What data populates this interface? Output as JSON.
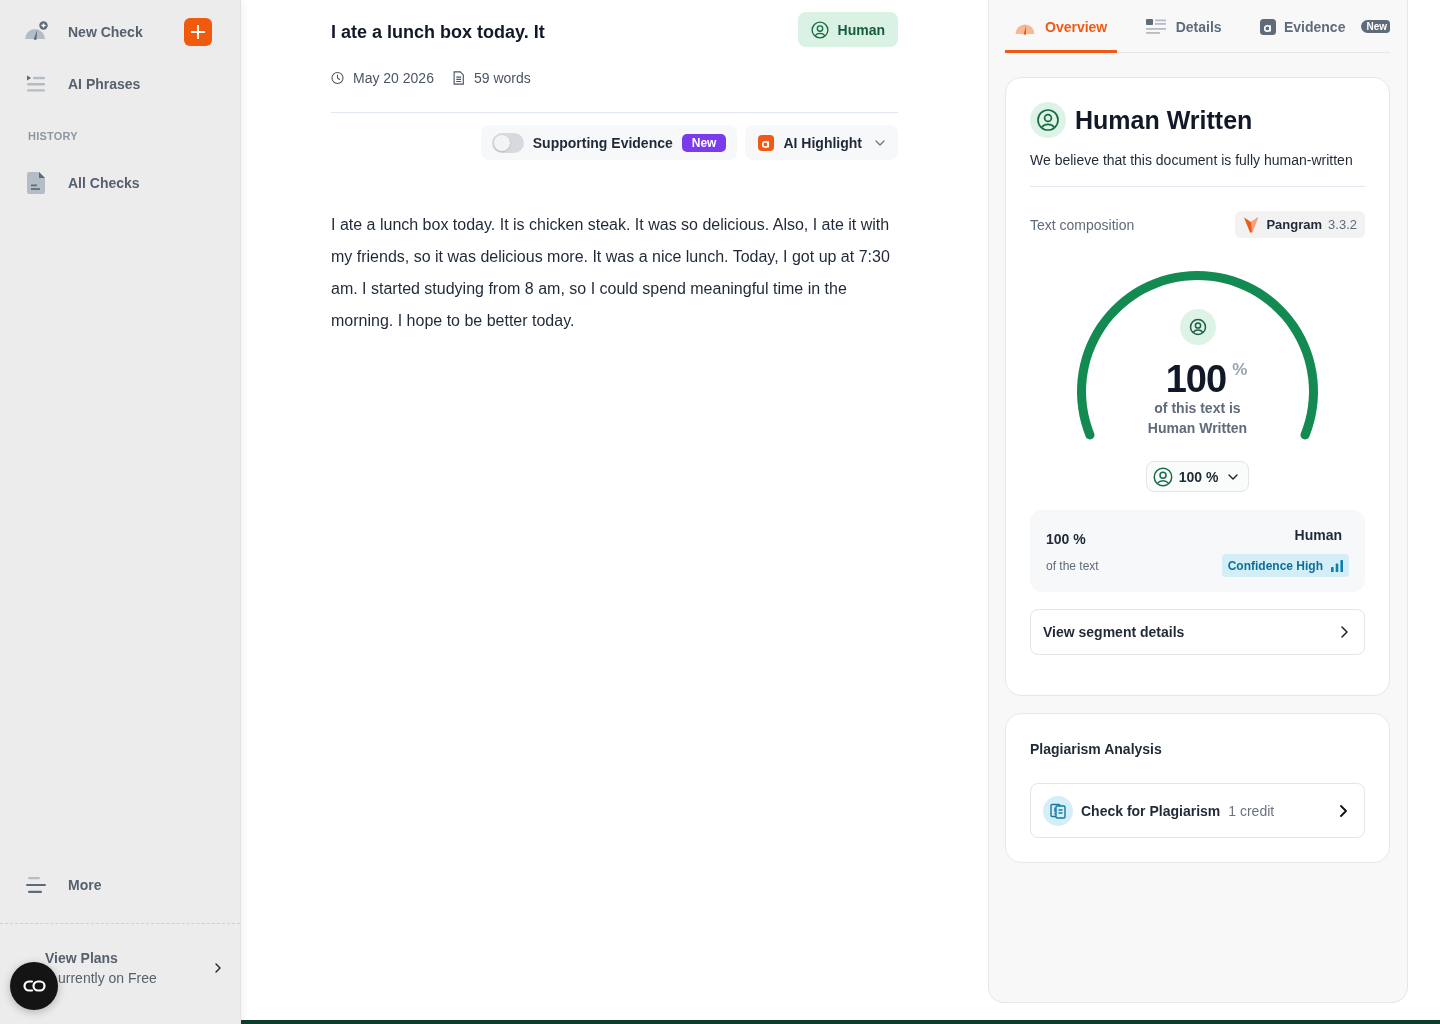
{
  "sidebar": {
    "nav_items": [
      {
        "label": "New Check",
        "kind": "new-check"
      },
      {
        "label": "AI Phrases",
        "kind": "phrases"
      }
    ],
    "history_heading": "HISTORY",
    "history_items": [
      {
        "label": "All Checks",
        "kind": "checks"
      }
    ],
    "more": {
      "label": "More"
    },
    "plan": {
      "title": "View Plans",
      "subtitle": "urrently on Free"
    }
  },
  "document": {
    "title": "I ate a lunch box today. It",
    "verdict": "Human",
    "date": "May 20 2026",
    "word_count": "59 words",
    "supporting_evidence": {
      "label": "Supporting Evidence",
      "on": false,
      "badge": "New"
    },
    "highlight": {
      "label": "AI Highlight"
    },
    "body": "I ate a lunch box today. It is chicken steak. It was so delicious. Also, I ate it with my friends, so it was delicious more. It was a nice lunch. Today, I got up at 7:30 am. I started studying from 8 am, so I could spend meaningful time in the morning. I hope to be better today."
  },
  "panel": {
    "tabs": [
      {
        "label": "Overview",
        "kind": "overview",
        "selected": true
      },
      {
        "label": "Details",
        "kind": "details",
        "selected": false
      },
      {
        "label": "Evidence",
        "kind": "evidence",
        "selected": false,
        "badge": "New"
      }
    ],
    "result": {
      "title": "Human Written",
      "description": "We believe that this document is fully human-written",
      "composition_label": "Text composition",
      "model": {
        "name": "Pangram",
        "version": "3.3.2"
      },
      "gauge": {
        "level": 1,
        "value": "100",
        "unit": "%",
        "caption": "of this text is Human Written"
      },
      "share_dropdown": "100 %",
      "summary": {
        "share": "100 %",
        "share_caption": "of the text",
        "class": "Human",
        "confidence": "Confidence High"
      },
      "segment_button": "View segment details"
    },
    "plagiarism": {
      "title": "Plagiarism Analysis",
      "action": "Check for Plagiarism",
      "cost": "1 credit"
    }
  }
}
